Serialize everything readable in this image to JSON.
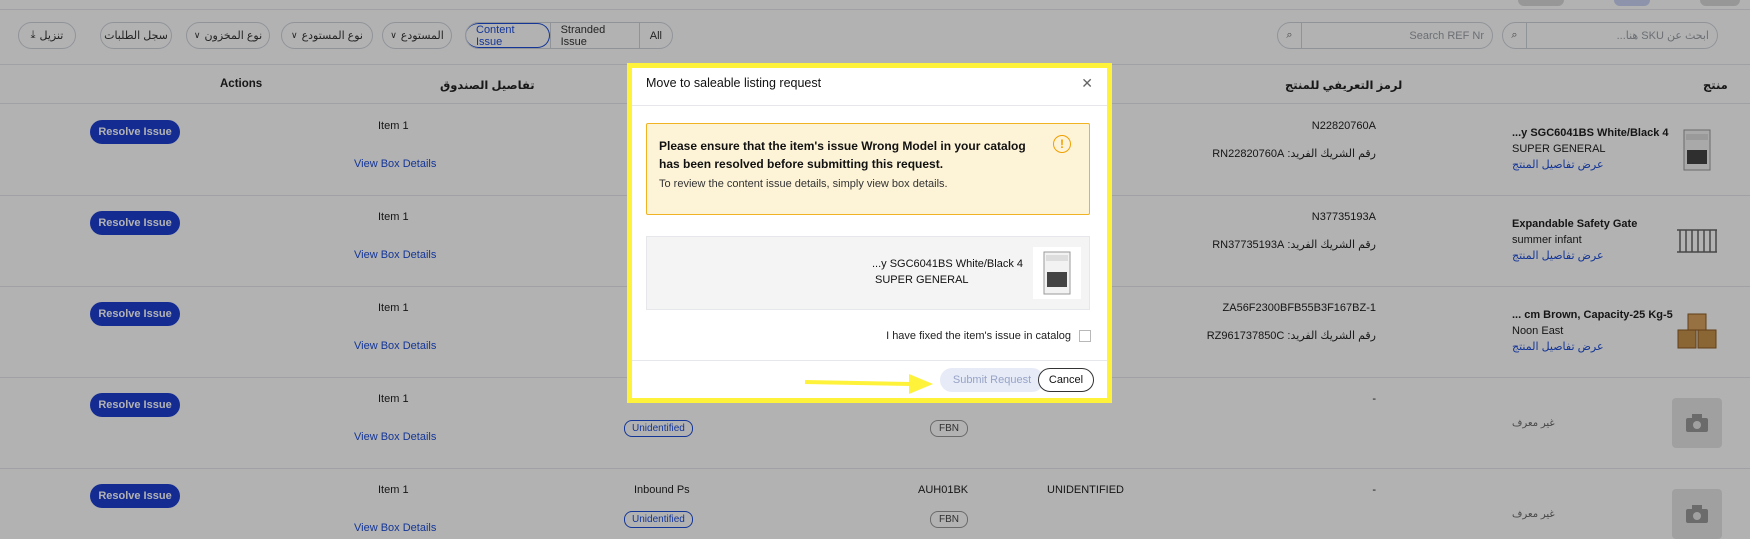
{
  "toolbar": {
    "download": "تنزيل",
    "requests_log": "سجل الطلبات",
    "stock_type": "نوع المخزون",
    "warehouse_type": "نوع المستودع",
    "warehouse": "المستودع",
    "tabs": [
      "Content Issue",
      "Stranded Issue",
      "All"
    ],
    "ref_search_placeholder": "Search REF Nr",
    "sku_search_placeholder": "ابحث عن SKU هنا..."
  },
  "table": {
    "headers": {
      "actions": "Actions",
      "box_details": "تفاصيل الصندوق",
      "product_id": "لرمز التعريفي للمنتج",
      "product": "منتج"
    },
    "rows": [
      {
        "action": "Resolve Issue",
        "item": "Item 1",
        "view": "View Box Details",
        "inbound": "",
        "location": "",
        "status": "",
        "sku": "N22820760A",
        "partner": "رقم الشريك الفريد: RN22820760A",
        "name": "...y SGC6041BS White/Black 4",
        "brand": "SUPER GENERAL",
        "link": "عرض تفاصيل المنتج"
      },
      {
        "action": "Resolve Issue",
        "item": "Item 1",
        "view": "View Box Details",
        "inbound": "",
        "location": "",
        "status": "",
        "sku": "N37735193A",
        "partner": "رقم الشريك الفريد: RN37735193A",
        "name": "Expandable Safety Gate",
        "brand": "summer infant",
        "link": "عرض تفاصيل المنتج"
      },
      {
        "action": "Resolve Issue",
        "item": "Item 1",
        "view": "View Box Details",
        "inbound": "",
        "location": "",
        "status": "",
        "sku": "ZA56F2300BFB55B3F167BZ-1",
        "partner": "رقم الشريك الفريد: RZ961737850C",
        "name": "... cm Brown, Capacity-25 Kg-5",
        "brand": "Noon East",
        "link": "عرض تفاصيل المنتج"
      },
      {
        "action": "Resolve Issue",
        "item": "Item 1",
        "view": "View Box Details",
        "inbound": "",
        "tag": "Unidentified",
        "location": "",
        "fbn": "FBN",
        "status": "",
        "sku": "-",
        "unknown": "غير معرف"
      },
      {
        "action": "Resolve Issue",
        "item": "Item 1",
        "view": "View Box Details",
        "inbound": "Inbound Ps",
        "tag": "Unidentified",
        "location": "AUH01BK",
        "fbn": "FBN",
        "status": "UNIDENTIFIED",
        "sku": "-",
        "unknown": "غير معرف"
      }
    ]
  },
  "modal": {
    "title": "Move to saleable listing request",
    "warning_main": "Please ensure that the item's issue Wrong Model in your catalog has been resolved before submitting this request.",
    "warning_sub": "To review the content issue details, simply view box details.",
    "product_name": "...y SGC6041BS White/Black 4",
    "product_brand": "SUPER GENERAL",
    "checkbox_label": "I have fixed the item's issue in catalog",
    "submit": "Submit Request",
    "cancel": "Cancel"
  },
  "icons": {
    "close": "close-icon",
    "warning": "warning-icon",
    "search": "search-icon",
    "download": "download-icon",
    "chevron": "chevron-down-icon",
    "camera": "camera-icon"
  },
  "colors": {
    "primary": "#1d3fd1",
    "highlight": "#fff23a",
    "warning_bg": "#fdf3d7",
    "warning_border": "#f0b323"
  }
}
